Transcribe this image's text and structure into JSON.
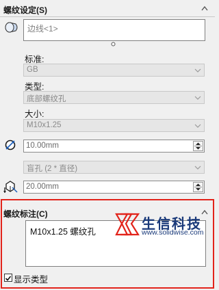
{
  "thread_settings": {
    "title": "螺纹设定(S)",
    "edge_selection": "边线<1>",
    "standard_label": "标准:",
    "standard_value": "GB",
    "type_label": "类型:",
    "type_value": "底部螺纹孔",
    "size_label": "大小:",
    "size_value": "M10x1.25",
    "diameter_value": "10.00mm",
    "end_condition_value": "盲孔 (2 * 直径)",
    "depth_value": "20.00mm"
  },
  "thread_callout": {
    "title": "螺纹标注(C)",
    "callout_text": "M10x1.25 螺纹孔",
    "show_type_label": "显示类型",
    "show_type_checked": true
  },
  "watermark": {
    "brand_cn": "生信科技",
    "url": "www.solidwise.com"
  },
  "colors": {
    "highlight_frame": "#e2231a",
    "watermark": "#1a3a7a"
  }
}
